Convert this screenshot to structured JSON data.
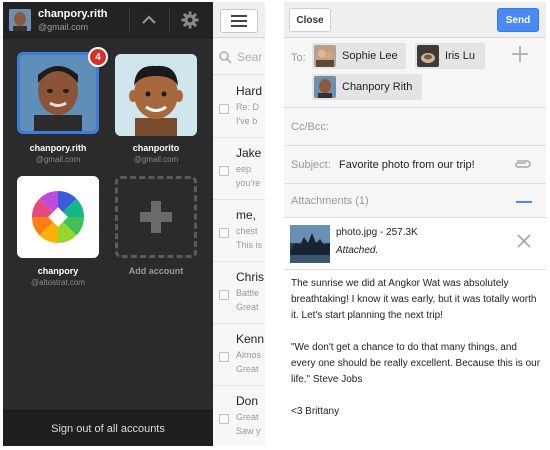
{
  "accounts_screen": {
    "header": {
      "name": "chanpory.rith",
      "email": "@gmail.com"
    },
    "accounts": [
      {
        "name": "chanpory.rith",
        "email": "@gmail.com",
        "unread_badge": "4",
        "avatar": "photo-avatar"
      },
      {
        "name": "chanporito",
        "email": "@gmail.com",
        "avatar": "cartoon-avatar"
      },
      {
        "name": "chanpory",
        "email": "@altostrat.com",
        "avatar": "colorful-logo-avatar"
      },
      {
        "name": "Add account",
        "avatar": "plus-icon"
      }
    ],
    "signout_label": "Sign out of all accounts"
  },
  "inbox": {
    "search_placeholder": "Sear",
    "messages": [
      {
        "from": "Hard",
        "subject": "Re: D",
        "snippet": "I've b"
      },
      {
        "from": "Jake",
        "subject": "eep",
        "snippet": "you're"
      },
      {
        "from": "me,",
        "subject": "chest",
        "snippet": "This is"
      },
      {
        "from": "Chris",
        "subject": "Battle",
        "snippet": "Great"
      },
      {
        "from": "Kenn",
        "subject": "Almos",
        "snippet": "Great"
      },
      {
        "from": "Don",
        "subject": "Great",
        "snippet": "Saw y"
      }
    ]
  },
  "compose": {
    "close_label": "Close",
    "send_label": "Send",
    "to_label": "To:",
    "recipients": [
      "Sophie Lee",
      "Iris Lu",
      "Chanpory Rith"
    ],
    "cc_label": "Cc/Bcc:",
    "subject_label": "Subject:",
    "subject_value": "Favorite photo from our trip!",
    "attachments_label": "Attachments (1)",
    "attachment": {
      "name": "photo.jpg - 257.3K",
      "status": "Attached."
    },
    "body": [
      "The sunrise we did at Angkor Wat was absolutely breathtaking! I know it was early, but it was totally worth it. Let's start planning the next trip!",
      "\"We don't get a chance to do that many things, and every one should be really excellent. Because this is our life.\" Steve Jobs",
      "<3 Brittany"
    ]
  },
  "colors": {
    "dark_panel": "#2b2b2b",
    "send_button": "#4a8af4",
    "badge": "#d93025"
  }
}
